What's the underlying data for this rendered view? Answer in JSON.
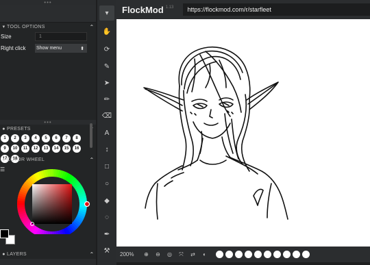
{
  "app": {
    "name": "FlockMod",
    "version": "1.13",
    "url": "https://flockmod.com/r/starfleet"
  },
  "grip": "•••",
  "tool_options": {
    "title": "TOOL OPTIONS",
    "size_label": "Size",
    "size_value": "1",
    "right_click_label": "Right click",
    "right_click_value": "Show menu"
  },
  "presets": {
    "title": "PRESETS",
    "items": [
      "1",
      "2",
      "3",
      "4",
      "5",
      "6",
      "7",
      "8",
      "9",
      "10",
      "11",
      "12",
      "13",
      "14",
      "15",
      "16",
      "17",
      "18"
    ]
  },
  "color_wheel": {
    "title": "COLOR WHEEL",
    "primary_color": "#000000",
    "secondary_color": "#ffffff",
    "hue_color": "#e01010"
  },
  "layers": {
    "title": "LAYERS"
  },
  "toolbar": {
    "tools": [
      {
        "name": "checkbox-tool",
        "icon": "▾"
      },
      {
        "name": "hand-tool",
        "icon": "✋"
      },
      {
        "name": "rotate-tool",
        "icon": "⟳"
      },
      {
        "name": "brush-tool",
        "icon": "✎"
      },
      {
        "name": "select-arrow-tool",
        "icon": "➤"
      },
      {
        "name": "pen-tool",
        "icon": "✏"
      },
      {
        "name": "eraser-tool",
        "icon": "⌫"
      },
      {
        "name": "text-tool",
        "icon": "A"
      },
      {
        "name": "move-tool",
        "icon": "↕"
      },
      {
        "name": "rectangle-tool",
        "icon": "□"
      },
      {
        "name": "ellipse-tool",
        "icon": "○"
      },
      {
        "name": "fill-tool",
        "icon": "◆"
      },
      {
        "name": "lasso-tool",
        "icon": "◌"
      },
      {
        "name": "eyedropper-tool",
        "icon": "✒"
      },
      {
        "name": "paint-roller-tool",
        "icon": "⚒"
      }
    ]
  },
  "bottom_bar": {
    "zoom": "200%",
    "icons": [
      "zoom-in-icon",
      "zoom-out-icon",
      "target-icon",
      "fullscreen-icon",
      "swap-icon",
      "contrast-icon"
    ],
    "icon_glyphs": [
      "⊕",
      "⊖",
      "◎",
      "⤧",
      "⇄",
      "◐"
    ]
  },
  "colors": {
    "panel": "#232526",
    "header": "#2b2d2f",
    "canvas": "#ffffff"
  }
}
